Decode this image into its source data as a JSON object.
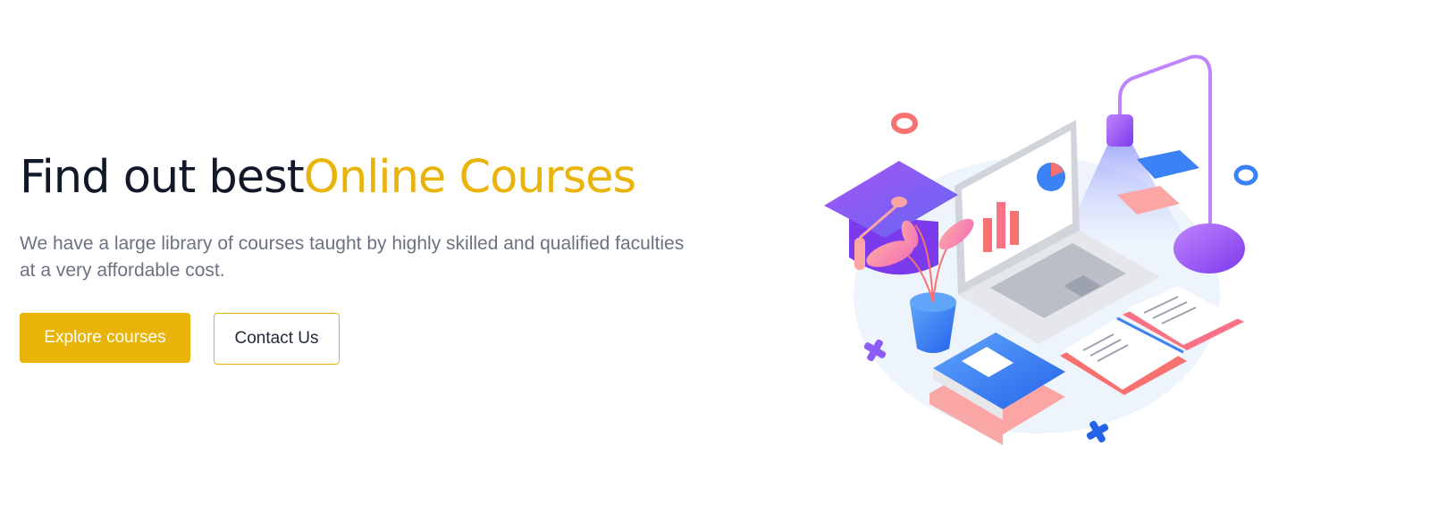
{
  "hero": {
    "title_prefix": "Find out best",
    "title_highlight": "Online Courses",
    "description": "We have a large library of courses taught by highly skilled and qualified faculties at a very affordable cost.",
    "primary_button": "Explore courses",
    "secondary_button": "Contact Us"
  },
  "colors": {
    "accent": "#eab308",
    "heading": "#111827",
    "body_text": "#6b7280",
    "illustration_purple": "#8b5cf6",
    "illustration_blue": "#3b82f6",
    "illustration_coral": "#f87171"
  },
  "illustration": {
    "icons": [
      "graduation-cap-icon",
      "laptop-icon",
      "desk-lamp-icon",
      "plant-pot-icon",
      "books-icon",
      "open-book-icon"
    ]
  }
}
